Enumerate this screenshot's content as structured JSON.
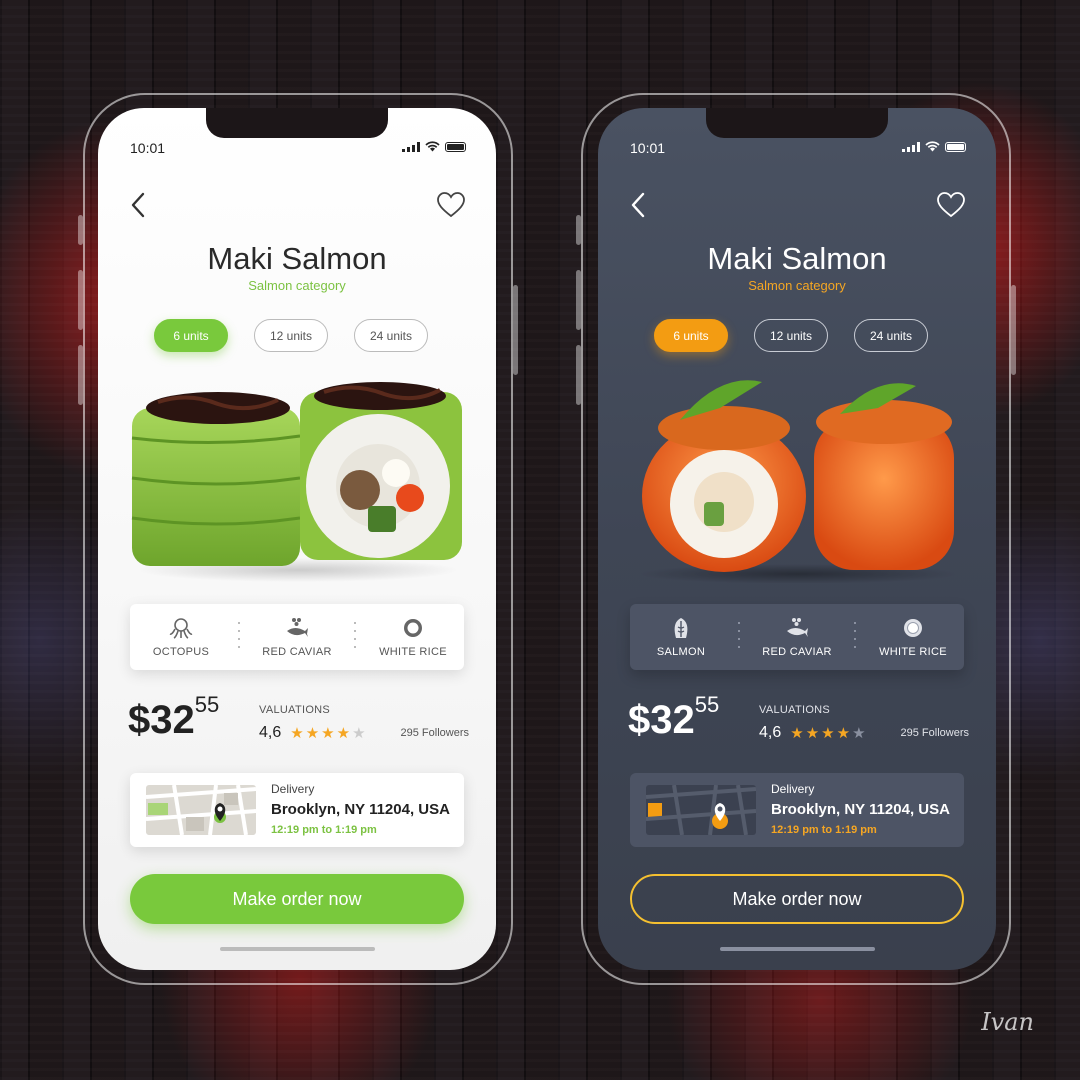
{
  "status": {
    "time": "10:01"
  },
  "product": {
    "title": "Maki Salmon",
    "category": "Salmon category",
    "units": [
      "6 units",
      "12 units",
      "24 units"
    ],
    "selected_unit": "6 units",
    "price_main": "$32",
    "price_cents": "55",
    "valuations_label": "VALUATIONS",
    "rating": "4,6",
    "stars": 4,
    "max_stars": 5,
    "followers": "295 Followers"
  },
  "light": {
    "ingredients": [
      {
        "label": "OCTOPUS",
        "icon": "octopus-icon"
      },
      {
        "label": "RED CAVIAR",
        "icon": "caviar-icon"
      },
      {
        "label": "WHITE RICE",
        "icon": "rice-icon"
      }
    ],
    "accent": "#79c93c"
  },
  "dark": {
    "ingredients": [
      {
        "label": "SALMON",
        "icon": "salmon-icon"
      },
      {
        "label": "RED CAVIAR",
        "icon": "caviar-icon"
      },
      {
        "label": "WHITE RICE",
        "icon": "rice-icon"
      }
    ],
    "accent": "#f39c12"
  },
  "delivery": {
    "label": "Delivery",
    "address": "Brooklyn, NY 11204, USA",
    "time": "12:19 pm to 1:19 pm"
  },
  "order_button": "Make order now",
  "signature": "Ivan"
}
